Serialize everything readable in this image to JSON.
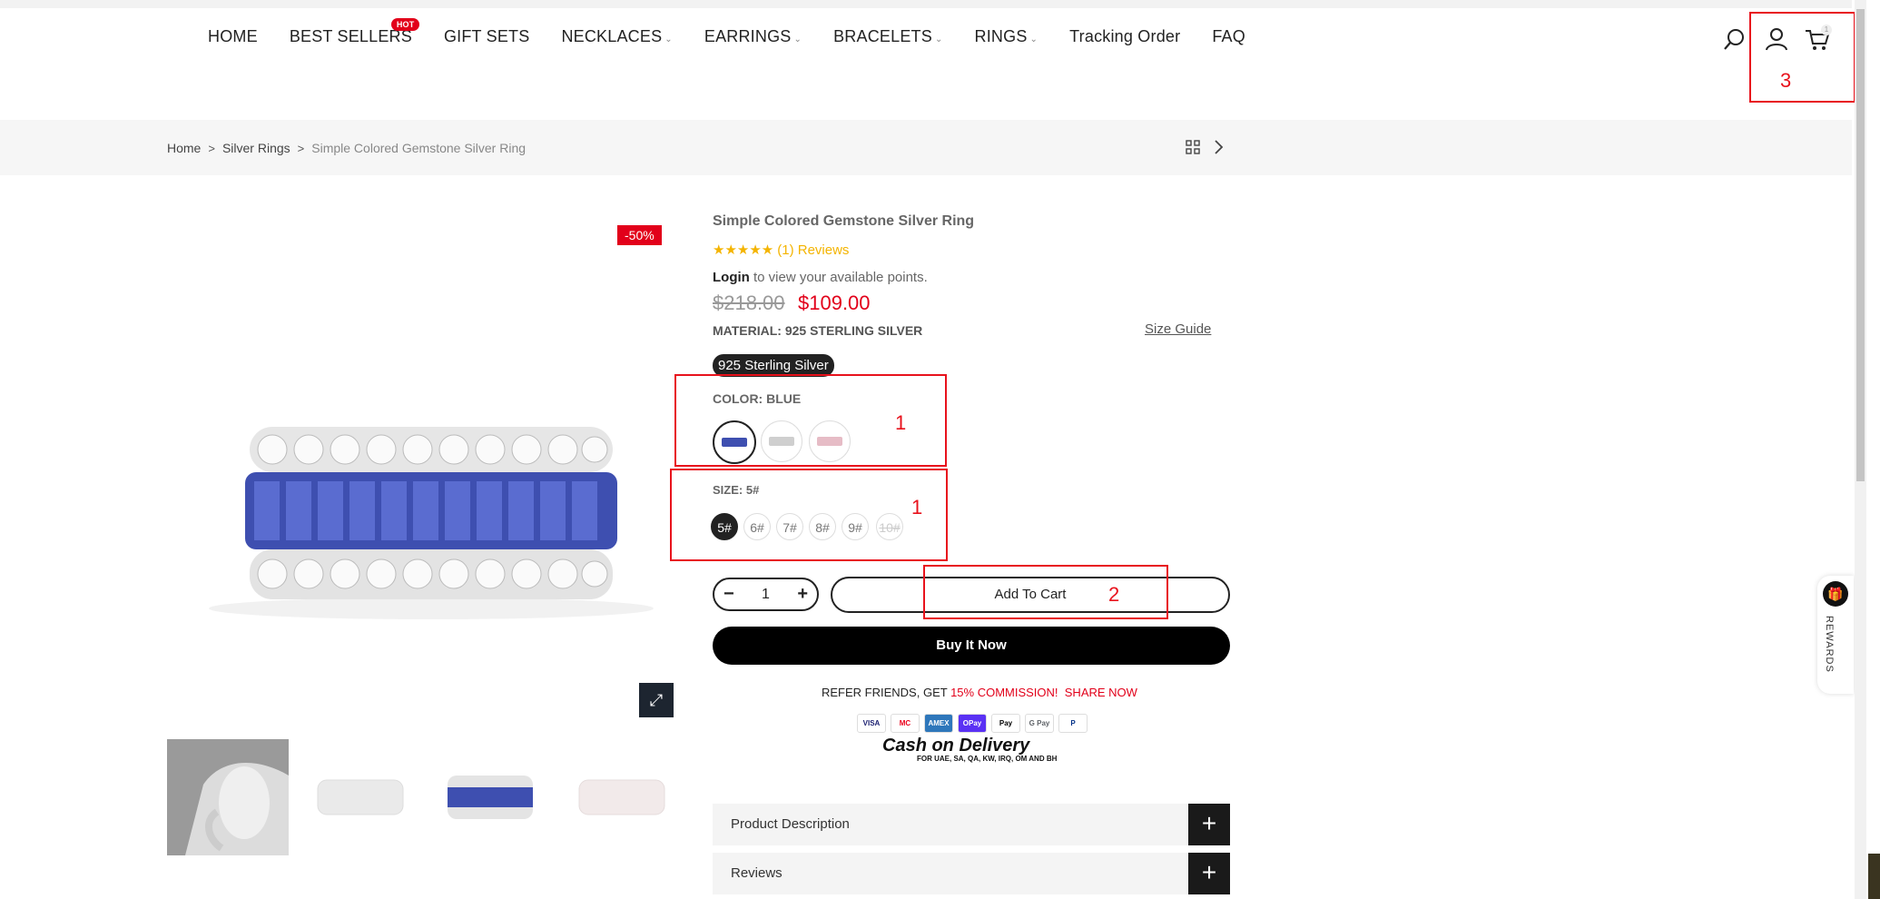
{
  "nav": {
    "items": [
      {
        "label": "HOME",
        "dropdown": false
      },
      {
        "label": "BEST SELLERS",
        "dropdown": false,
        "badge": "HOT"
      },
      {
        "label": "GIFT SETS",
        "dropdown": false
      },
      {
        "label": "NECKLACES",
        "dropdown": true
      },
      {
        "label": "EARRINGS",
        "dropdown": true
      },
      {
        "label": "BRACELETS",
        "dropdown": true
      },
      {
        "label": "RINGS",
        "dropdown": true
      },
      {
        "label": "Tracking Order",
        "dropdown": false
      },
      {
        "label": "FAQ",
        "dropdown": false
      }
    ],
    "cart_count": "1"
  },
  "annotations": {
    "a1": "1",
    "a2": "1",
    "a3": "2",
    "a4": "3"
  },
  "breadcrumb": {
    "home": "Home",
    "category": "Silver Rings",
    "current": "Simple Colored Gemstone Silver Ring",
    "sep": ">"
  },
  "product": {
    "sale_badge": "-50%",
    "title": "Simple Colored Gemstone Silver Ring",
    "stars": "★★★★★",
    "reviews_link": "(1) Reviews",
    "login_bold": "Login",
    "login_rest": " to view your available points.",
    "price_old": "$218.00",
    "price_new": "$109.00",
    "material": "MATERIAL: 925 STERLING SILVER",
    "size_guide": "Size Guide",
    "material_option": "925 Sterling Silver",
    "color_label": "COLOR: BLUE",
    "size_label": "SIZE: 5#",
    "sizes": [
      "5#",
      "6#",
      "7#",
      "8#",
      "9#",
      "10#"
    ],
    "quantity": "1",
    "minus": "−",
    "plus": "+",
    "add_to_cart": "Add To Cart",
    "buy_now": "Buy It Now"
  },
  "promo": {
    "refer_prefix": "REFER FRIENDS, GET ",
    "refer_red": "15% COMMISSION!",
    "share": "SHARE NOW",
    "payments": [
      "VISA",
      "MC",
      "AMEX",
      "OPay",
      "Pay",
      "G Pay",
      "P"
    ],
    "cod_title": "Cash on Delivery",
    "cod_sub": "FOR UAE, SA, QA, KW, IRQ, OM AND BH"
  },
  "accordions": {
    "desc": "Product Description",
    "reviews": "Reviews",
    "toggle": "+"
  },
  "rewards": {
    "label": "REWARDS"
  },
  "colors": {
    "accent": "#e2001a",
    "annotation": "#e8121c",
    "dark": "#222222"
  }
}
